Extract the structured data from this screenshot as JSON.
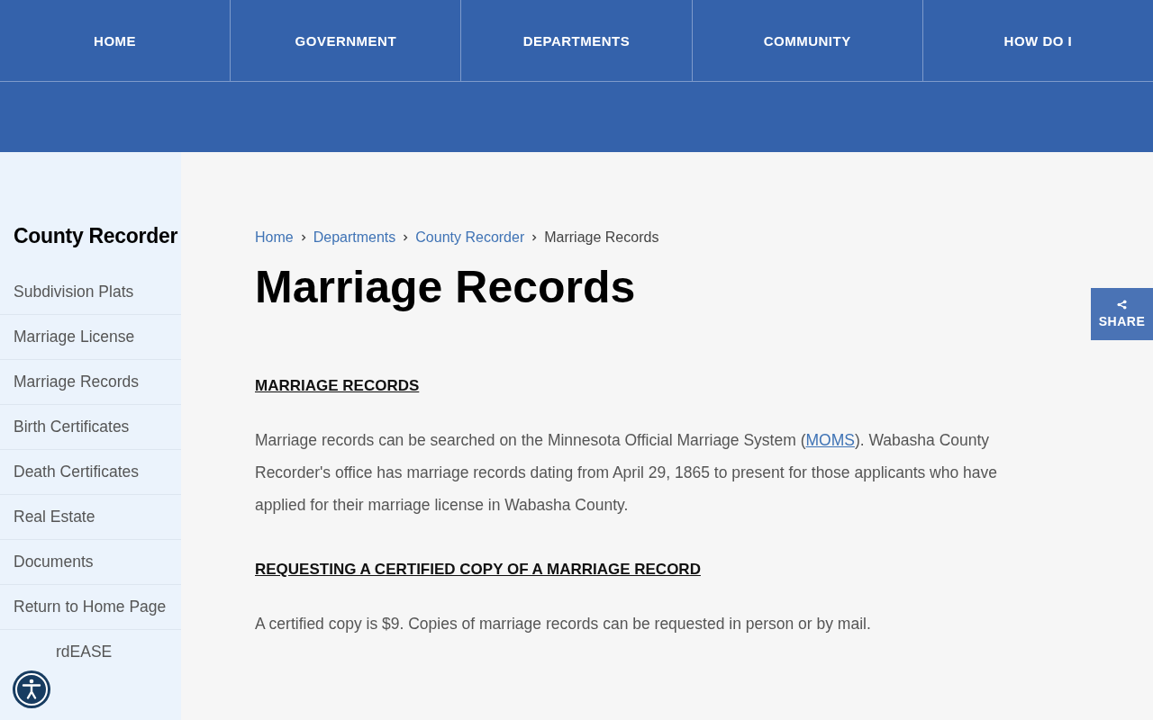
{
  "nav": {
    "items": [
      {
        "label": "HOME"
      },
      {
        "label": "GOVERNMENT"
      },
      {
        "label": "DEPARTMENTS"
      },
      {
        "label": "COMMUNITY"
      },
      {
        "label": "HOW DO I"
      }
    ]
  },
  "sidebar": {
    "title": "County Recorder",
    "items": [
      {
        "label": "Subdivision Plats"
      },
      {
        "label": "Marriage License"
      },
      {
        "label": "Marriage Records"
      },
      {
        "label": "Birth Certificates"
      },
      {
        "label": "Death Certificates"
      },
      {
        "label": "Real Estate"
      },
      {
        "label": "Documents"
      },
      {
        "label": "Return to Home Page"
      },
      {
        "label": "rdEASE"
      }
    ]
  },
  "breadcrumb": [
    {
      "label": "Home",
      "link": true
    },
    {
      "label": "Departments",
      "link": true
    },
    {
      "label": "County Recorder",
      "link": true
    },
    {
      "label": "Marriage Records",
      "link": false
    }
  ],
  "title": "Marriage Records",
  "sections": [
    {
      "heading": "MARRIAGE RECORDS",
      "paragraph": [
        {
          "text": "Marriage records can be searched on the Minnesota Official Marriage System ("
        },
        {
          "link": "MOMS"
        },
        {
          "text": "). Wabasha County Recorder's office has marriage records dating from  April 29, 1865 to present for those applicants who have applied for their marriage license in Wabasha County."
        }
      ]
    },
    {
      "heading": "REQUESTING A CERTIFIED COPY OF A MARRIAGE RECORD",
      "paragraph": [
        {
          "text": "A certified copy is $9. Copies of marriage records can be requested in person or by mail."
        }
      ]
    }
  ],
  "share_button": {
    "label": "SHARE"
  }
}
